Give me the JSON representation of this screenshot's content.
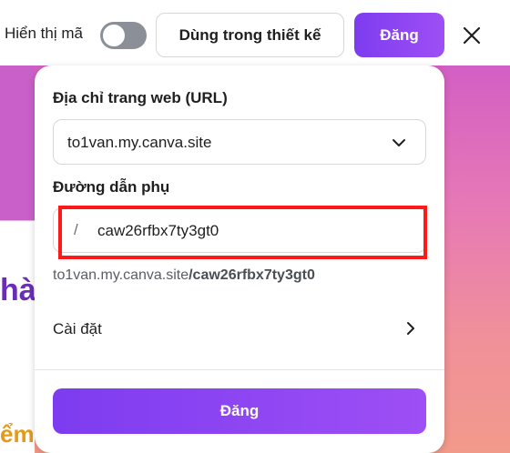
{
  "topbar": {
    "show_code_label": "Hiển thị mã",
    "show_code_on": false,
    "use_in_design_label": "Dùng trong thiết kế",
    "publish_label": "Đăng",
    "close_icon": "close-icon"
  },
  "background": {
    "text1": "hà",
    "text2": "ểm"
  },
  "panel": {
    "url_label": "Địa chỉ trang web (URL)",
    "url_value": "to1van.my.canva.site",
    "subpath_label": "Đường dẫn phụ",
    "subpath_prefix": "/",
    "subpath_value": "caw26rfbx7ty3gt0",
    "preview_domain": "to1van.my.canva.site",
    "preview_path": "/caw26rfbx7ty3gt0",
    "settings_label": "Cài đặt",
    "publish_label": "Đăng"
  },
  "colors": {
    "accent": "#8b45f2",
    "highlight": "#ff1a1a"
  }
}
